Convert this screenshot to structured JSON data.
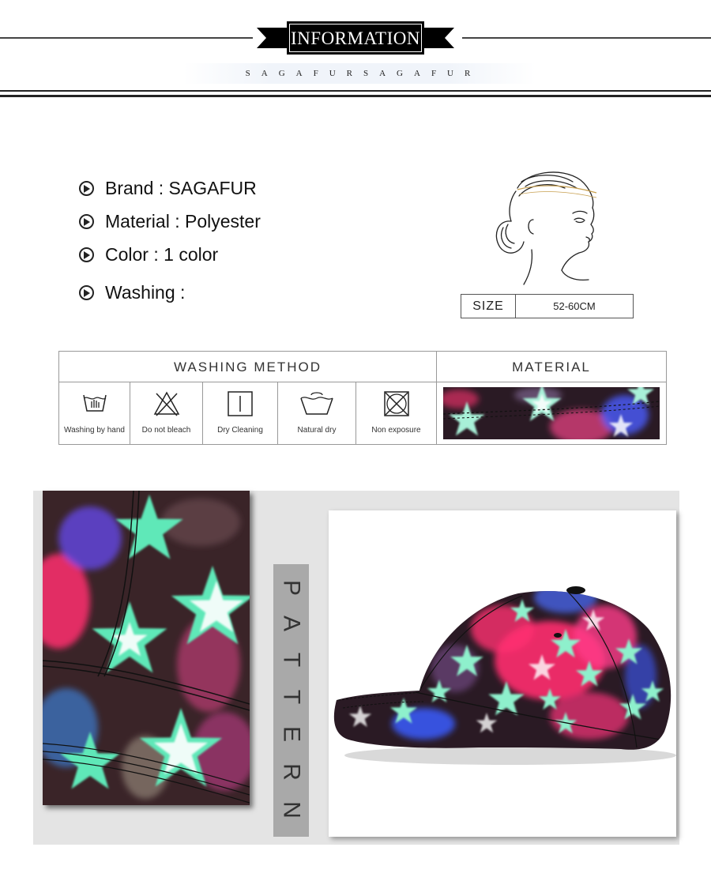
{
  "header": {
    "title": "INFORMATION",
    "subtitle": "SAGAFURSAGAFUR"
  },
  "info": [
    {
      "label": "Brand : SAGAFUR"
    },
    {
      "label": "Material : Polyester"
    },
    {
      "label": "Color : 1 color"
    },
    {
      "label": "Washing :"
    }
  ],
  "size": {
    "label": "SIZE",
    "value": "52-60CM"
  },
  "washing_table": {
    "method_header": "WASHING METHOD",
    "material_header": "MATERIAL",
    "items": [
      {
        "caption": "Washing by hand",
        "icon": "hand-wash-icon"
      },
      {
        "caption": "Do not bleach",
        "icon": "no-bleach-icon"
      },
      {
        "caption": "Dry Cleaning",
        "icon": "dry-clean-icon"
      },
      {
        "caption": "Natural dry",
        "icon": "natural-dry-icon"
      },
      {
        "caption": "Non exposure",
        "icon": "non-exposure-icon"
      }
    ]
  },
  "pattern": {
    "letters": [
      "P",
      "A",
      "T",
      "T",
      "E",
      "R",
      "N"
    ]
  },
  "colors": {
    "fabric_dark": "#2a1a20",
    "star_mint": "#a8f0d8",
    "pink": "#ff2d6e",
    "blue": "#3a5cff",
    "gallery_bg": "#e4e4e4",
    "pattern_bar": "#a9a9a9"
  }
}
